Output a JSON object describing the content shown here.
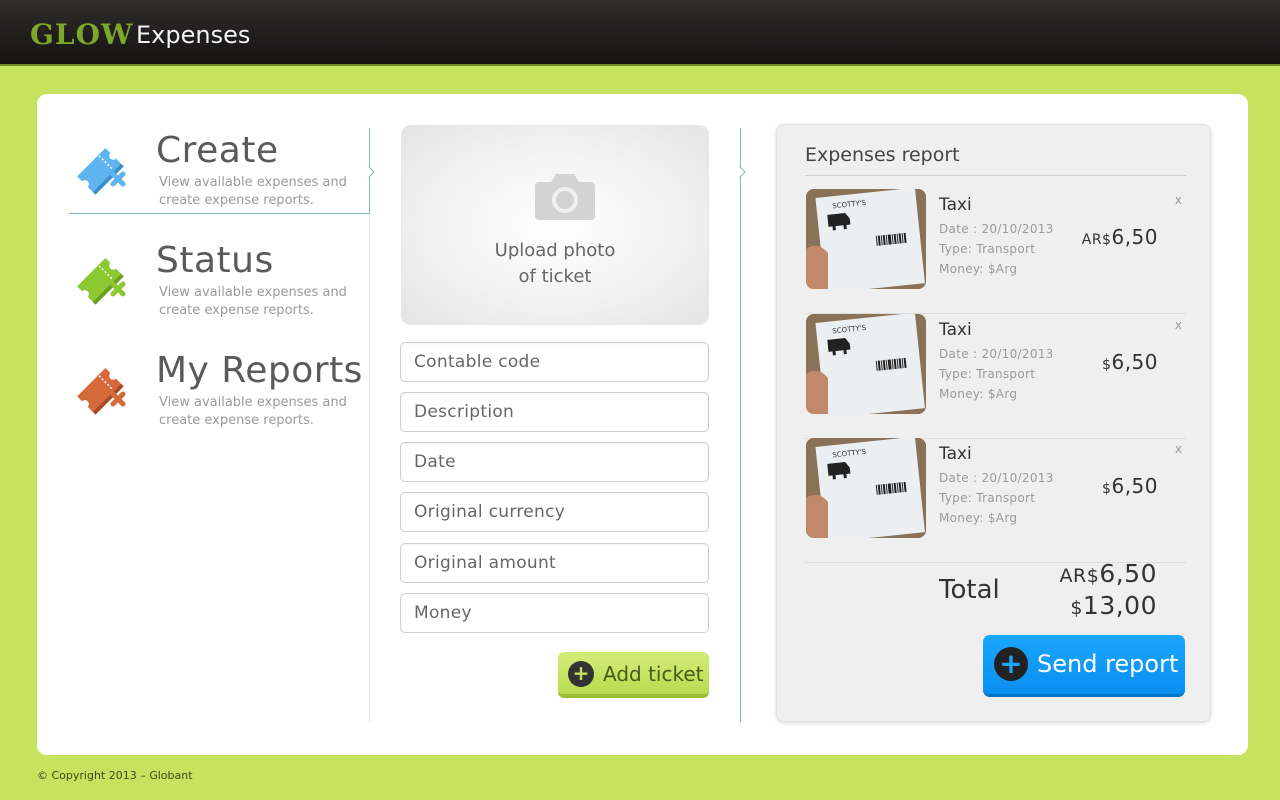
{
  "header": {
    "logo": "GLOW",
    "app_title": "Expenses"
  },
  "nav": {
    "items": [
      {
        "title": "Create",
        "description": "View available expenses and create expense reports.",
        "icon": "ticket-blue-icon",
        "color": "#5fb4ef"
      },
      {
        "title": "Status",
        "description": "View available expenses and create expense reports.",
        "icon": "ticket-green-icon",
        "color": "#8bc832"
      },
      {
        "title": "My Reports",
        "description": "View available expenses and create expense reports.",
        "icon": "ticket-orange-icon",
        "color": "#d5693a"
      }
    ]
  },
  "form": {
    "upload_line1": "Upload photo",
    "upload_line2": "of ticket",
    "fields": [
      "Contable code",
      "Description",
      "Date",
      "Original currency",
      "Original amount",
      "Money"
    ],
    "add_label": "Add ticket"
  },
  "report": {
    "title": "Expenses report",
    "tickets": [
      {
        "name": "Taxi",
        "date": "Date : 20/10/2013",
        "type": "Type: Transport",
        "money": "Money: $Arg",
        "currency": "AR$",
        "amount": "6,50",
        "close": "x"
      },
      {
        "name": "Taxi",
        "date": "Date : 20/10/2013",
        "type": "Type: Transport",
        "money": "Money: $Arg",
        "currency": "$",
        "amount": "6,50",
        "close": "x"
      },
      {
        "name": "Taxi",
        "date": "Date : 20/10/2013",
        "type": "Type: Transport",
        "money": "Money: $Arg",
        "currency": "$",
        "amount": "6,50",
        "close": "x"
      }
    ],
    "total_label": "Total",
    "total_1_currency": "AR$",
    "total_1_amount": "6,50",
    "total_2_currency": "$",
    "total_2_amount": "13,00",
    "send_label": "Send report"
  },
  "footer": {
    "copyright": "© Copyright 2013 – Globant"
  },
  "colors": {
    "accent_green": "#c5e35e",
    "accent_blue": "#0a8ef0",
    "divider": "#7eb7c9"
  }
}
